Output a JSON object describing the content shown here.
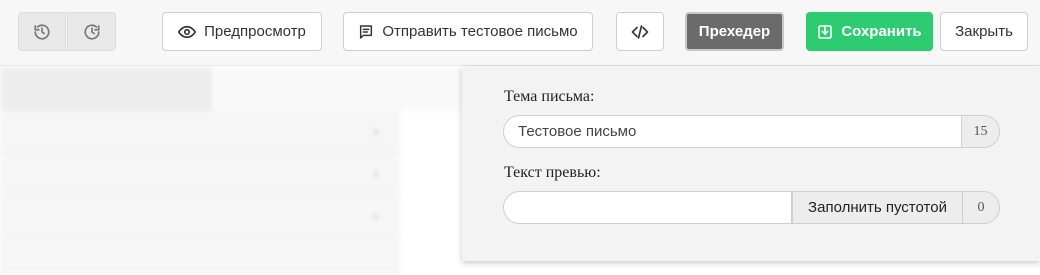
{
  "toolbar": {
    "preview_label": "Предпросмотр",
    "send_test_label": "Отправить тестовое письмо",
    "preheader_label": "Прехедер",
    "save_label": "Сохранить",
    "close_label": "Закрыть"
  },
  "icons": {
    "undo": "history-back-icon",
    "redo": "history-forward-icon",
    "preview": "eye-icon",
    "send_test": "message-icon",
    "code": "code-icon",
    "save": "save-icon"
  },
  "colors": {
    "save_button": "#2ecc71",
    "preheader_button": "#6b6b6b",
    "panel_background": "#f3f3f3"
  },
  "preheader_panel": {
    "subject_label": "Тема письма:",
    "subject_value": "Тестовое письмо",
    "subject_count": "15",
    "preview_text_label": "Текст превью:",
    "preview_text_value": "",
    "fill_empty_label": "Заполнить пустотой",
    "preview_text_count": "0"
  }
}
